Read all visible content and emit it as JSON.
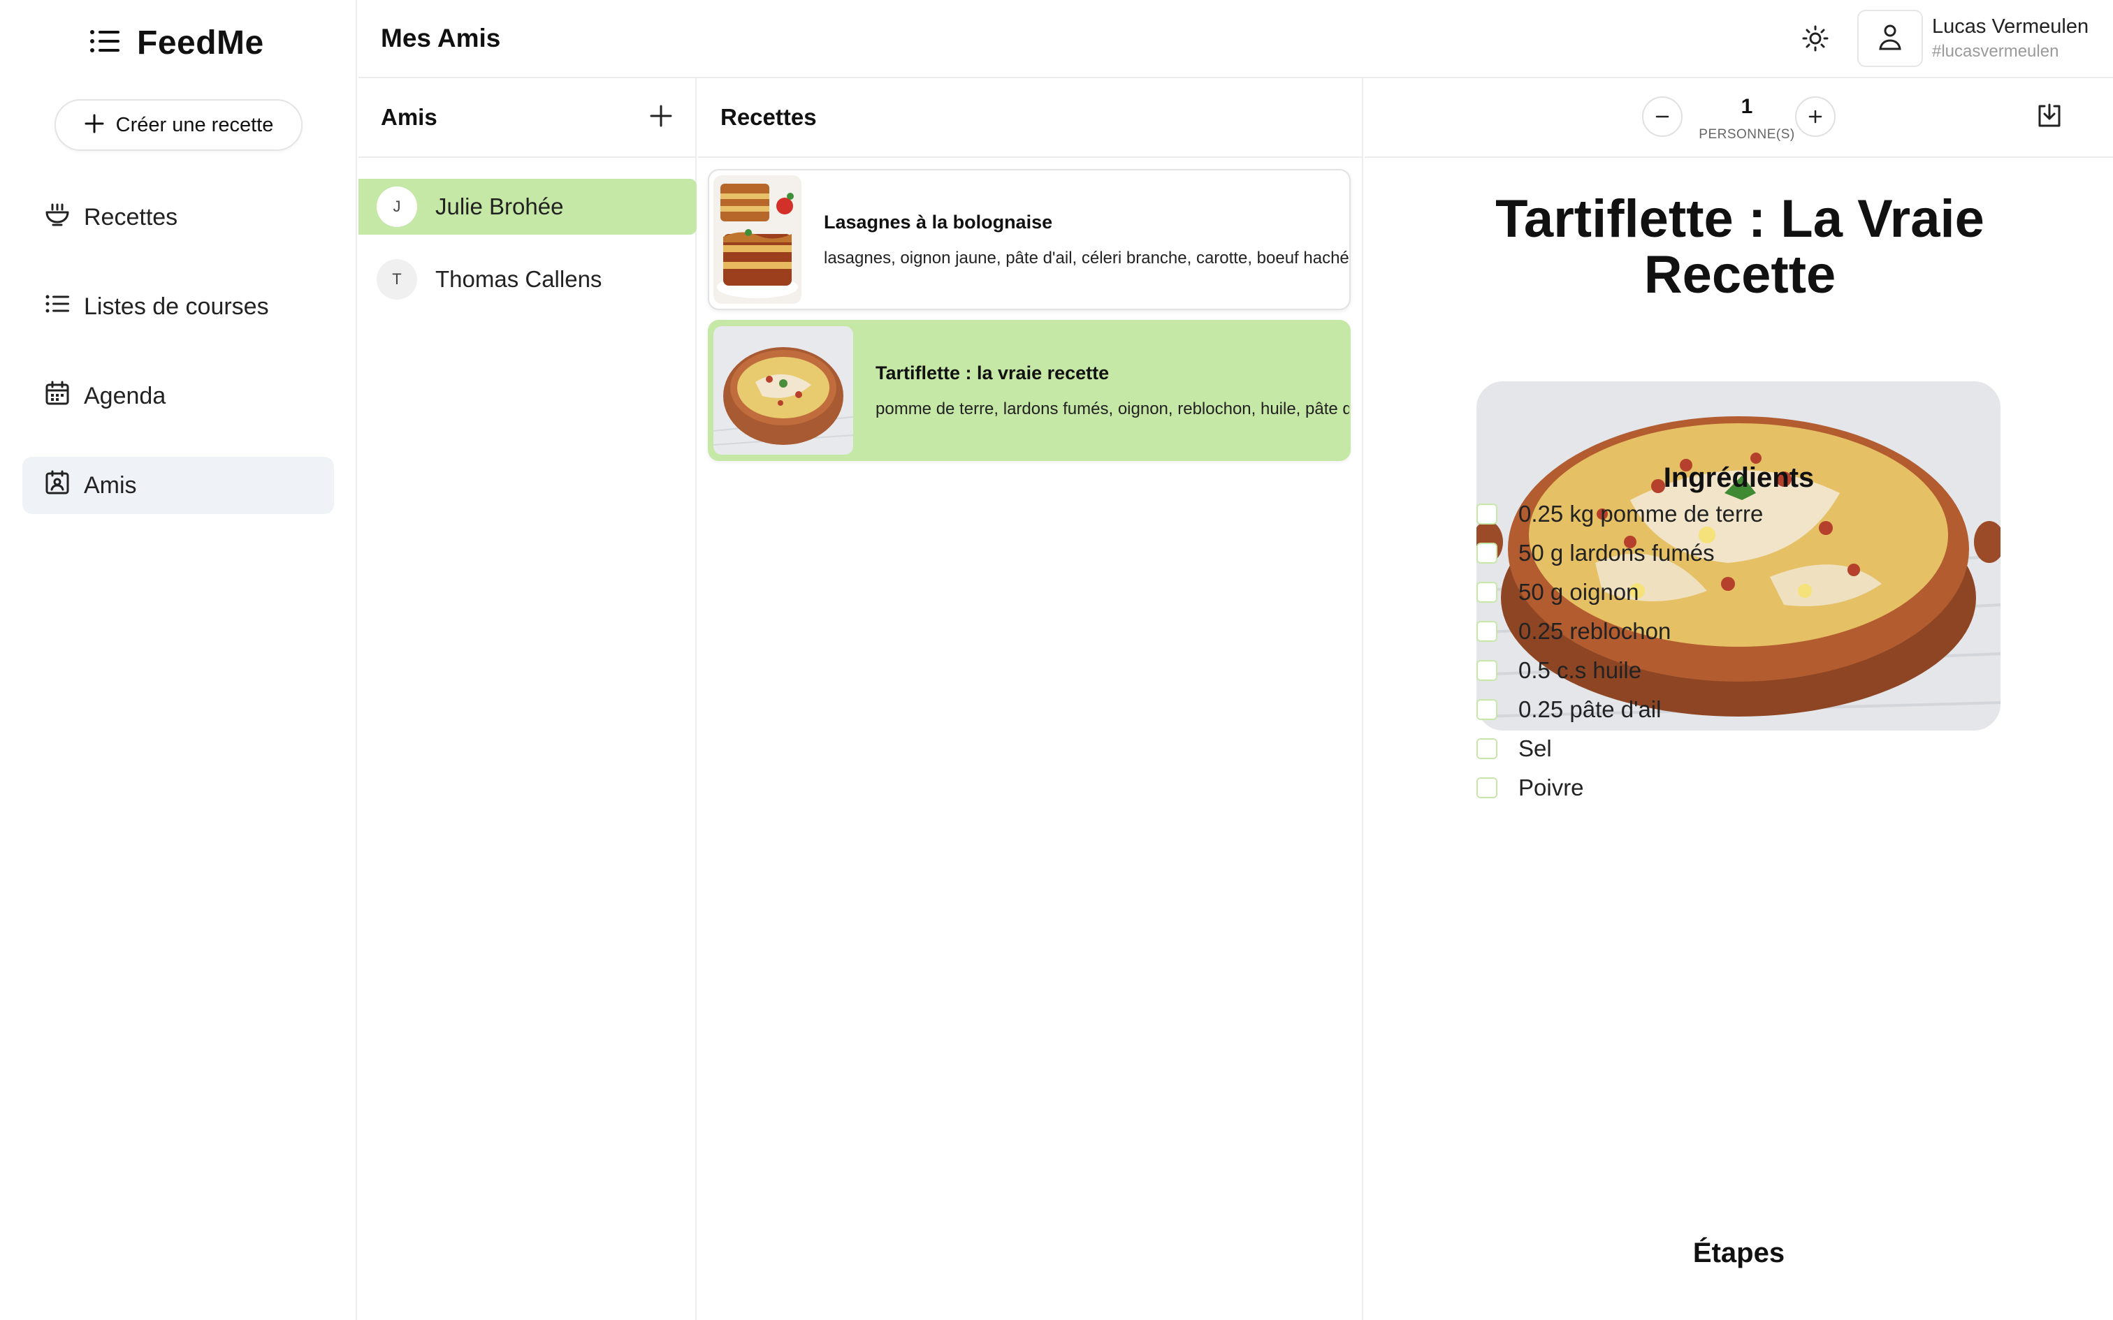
{
  "app": {
    "name": "FeedMe",
    "create_recipe_label": "Créer une recette"
  },
  "sidebar": {
    "items": [
      {
        "label": "Recettes",
        "icon": "bowl-icon",
        "active": false
      },
      {
        "label": "Listes de courses",
        "icon": "list-icon",
        "active": false
      },
      {
        "label": "Agenda",
        "icon": "calendar-icon",
        "active": false
      },
      {
        "label": "Amis",
        "icon": "contact-icon",
        "active": true
      }
    ]
  },
  "header": {
    "title": "Mes Amis",
    "user": {
      "name": "Lucas Vermeulen",
      "handle": "#lucasvermeulen"
    }
  },
  "friends": {
    "title": "Amis",
    "items": [
      {
        "initial": "J",
        "name": "Julie Brohée",
        "active": true
      },
      {
        "initial": "T",
        "name": "Thomas Callens",
        "active": false
      }
    ]
  },
  "recipes": {
    "title": "Recettes",
    "items": [
      {
        "title": "Lasagnes à la bolognaise",
        "ingredients": "lasagnes, oignon jaune, pâte d'ail, céleri branche, carotte, boeuf haché",
        "active": false
      },
      {
        "title": "Tartiflette : la vraie recette",
        "ingredients": "pomme de terre, lardons fumés, oignon, reblochon, huile, pâte d'ail",
        "active": true
      }
    ]
  },
  "detail": {
    "servings": {
      "count": "1",
      "unit": "PERSONNE(S)"
    },
    "title": "Tartiflette : La Vraie Recette",
    "ingredients_title": "Ingrédients",
    "ingredients": [
      "0.25 kg pomme de terre",
      "50 g lardons fumés",
      "50 g oignon",
      "0.25 reblochon",
      "0.5 c.s huile",
      "0.25 pâte d'ail",
      "Sel",
      "Poivre"
    ],
    "steps_title": "Étapes"
  },
  "colors": {
    "accent": "#c6e8a6",
    "border": "#ececec",
    "active_nav": "#eff2f6"
  }
}
